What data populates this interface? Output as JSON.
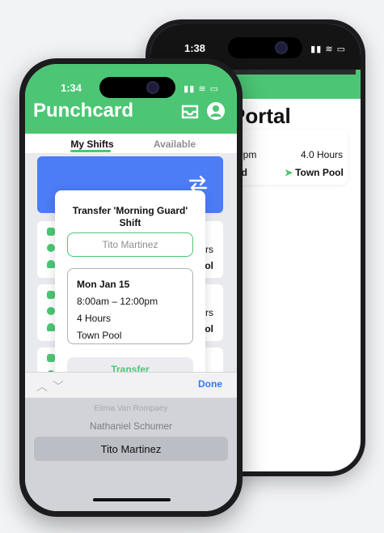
{
  "back_phone": {
    "status_time": "1:38",
    "title": "Portal",
    "row1_left": "0pm",
    "row1_right": "4.0 Hours",
    "row2_left": "rd",
    "row2_right": "Town Pool"
  },
  "front_phone": {
    "status_time": "1:34",
    "app_title": "Punchcard",
    "tabs": [
      {
        "label": "My Shifts",
        "active": true
      },
      {
        "label": "Available",
        "active": false
      }
    ],
    "background_card_snippets": [
      "urs",
      "ool",
      "urs",
      "ool",
      "urs"
    ],
    "modal": {
      "title": "Transfer 'Morning Guard' Shift",
      "selected_name": "Tito Martinez",
      "shift": {
        "date": "Mon Jan 15",
        "time": "8:00am – 12:00pm",
        "hours": "4 Hours",
        "location": "Town Pool"
      },
      "transfer_label": "Transfer"
    },
    "keyboard": {
      "done_label": "Done",
      "picker_options": [
        "Elena Van Rompaey",
        "Nathaniel Schumer",
        "Tito Martinez"
      ]
    }
  },
  "colors": {
    "accent_green": "#4cc674",
    "blue_banner": "#4c7cf6",
    "done_blue": "#2f7cf6"
  }
}
